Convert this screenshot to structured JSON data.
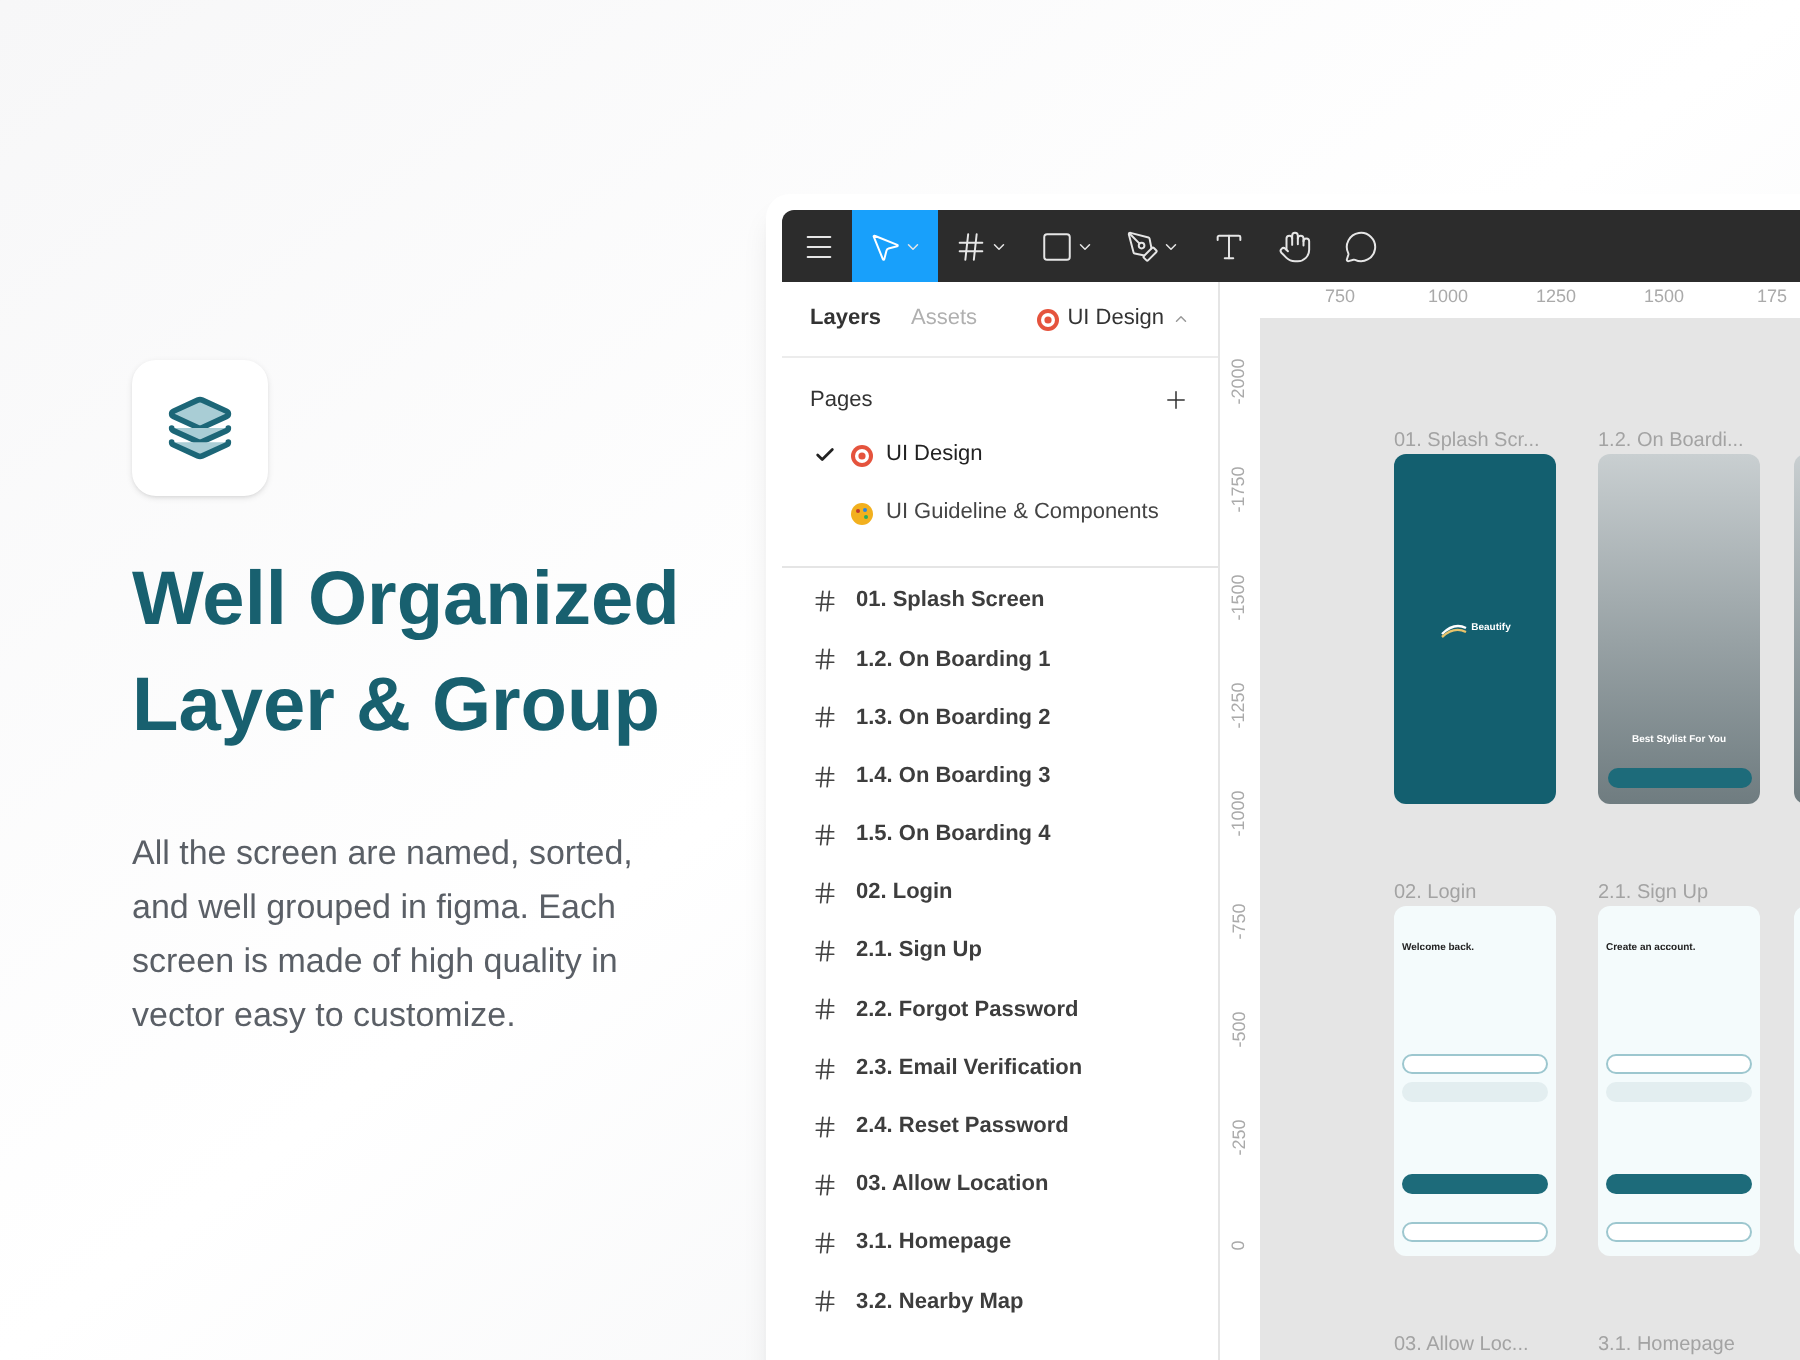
{
  "hero": {
    "title_lines": [
      "Well Organized",
      "Layer & Group"
    ],
    "description": "All the screen are named, sorted, and well grouped in figma. Each screen is made of high quality in vector easy to customize."
  },
  "toolbar": {
    "tools": [
      {
        "kind": "menu",
        "selected": false
      },
      {
        "kind": "move",
        "selected": true
      },
      {
        "kind": "frame",
        "selected": false
      },
      {
        "kind": "shape",
        "selected": false
      },
      {
        "kind": "pen",
        "selected": false
      },
      {
        "kind": "text",
        "selected": false
      },
      {
        "kind": "hand",
        "selected": false
      },
      {
        "kind": "comment",
        "selected": false
      }
    ]
  },
  "panel": {
    "tabs": [
      {
        "label": "Layers",
        "selected": true
      },
      {
        "label": "Assets",
        "selected": false
      }
    ],
    "page_switcher": "UI Design",
    "pages_heading": "Pages",
    "pages": [
      {
        "label": "UI Design",
        "selected": true,
        "kind": "target"
      },
      {
        "label": "UI Guideline & Components",
        "selected": false,
        "kind": "palette"
      }
    ],
    "layers": [
      "01. Splash Screen",
      "1.2. On Boarding 1",
      "1.3. On Boarding 2",
      "1.4. On Boarding 3",
      "1.5. On Boarding 4",
      "02. Login",
      "2.1. Sign Up",
      "2.2. Forgot Password",
      "2.3. Email Verification",
      "2.4. Reset Password",
      "03. Allow Location",
      "3.1. Homepage",
      "3.2. Nearby Map"
    ]
  },
  "ruler": {
    "x_labels": [
      "750",
      "1000",
      "1250",
      "1500",
      "175"
    ],
    "y_labels": [
      "-2000",
      "-1750",
      "-1500",
      "-1250",
      "-1000",
      "-750",
      "-500",
      "-250",
      "0"
    ]
  },
  "frames": [
    {
      "label": "01. Splash Scr...",
      "kind": "splash",
      "brand": "Beautify"
    },
    {
      "label": "1.2. On Boardi...",
      "kind": "photo",
      "headline": "Best Stylist For You"
    },
    {
      "kind": "photo"
    },
    {
      "label": "02. Login",
      "kind": "form",
      "headline": "Welcome back."
    },
    {
      "label": "2.1. Sign Up",
      "kind": "form",
      "headline": "Create an account."
    },
    {
      "kind": "form"
    },
    {
      "label": "03. Allow Loc...",
      "kind": "none"
    },
    {
      "label": "3.1. Homepage",
      "kind": "none"
    }
  ]
}
